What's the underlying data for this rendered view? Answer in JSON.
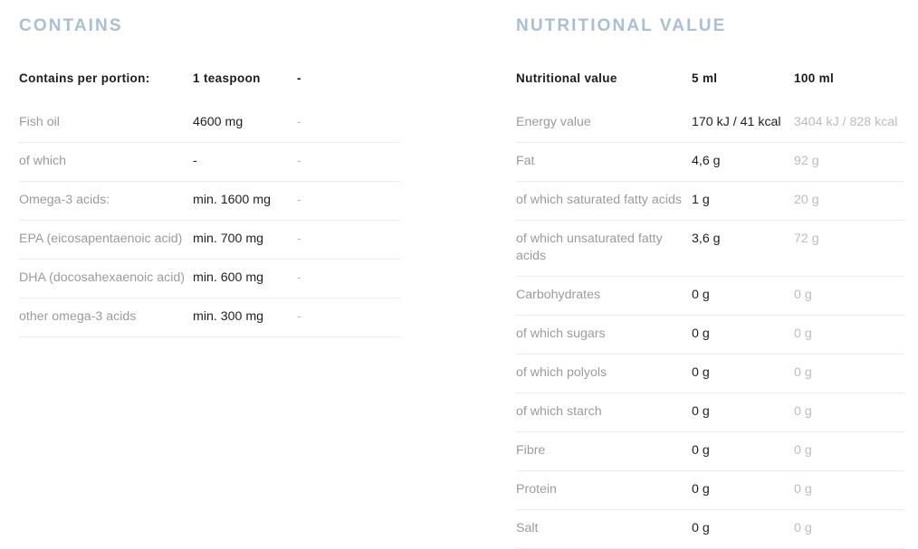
{
  "sections": [
    {
      "id": "contains",
      "title": "CONTAINS",
      "table": {
        "headers": [
          "Contains per portion:",
          "1 teaspoon",
          "-"
        ],
        "rows": [
          {
            "label": "Fish oil",
            "primary": "4600 mg",
            "muted": "-"
          },
          {
            "label": "of which",
            "primary": "-",
            "muted": "-"
          },
          {
            "label": "Omega-3 acids:",
            "primary": "min. 1600 mg",
            "muted": "-"
          },
          {
            "label": "EPA (eicosapentaenoic acid)",
            "primary": "min. 700 mg",
            "muted": "-"
          },
          {
            "label": "DHA (docosahexaenoic acid)",
            "primary": "min. 600 mg",
            "muted": "-"
          },
          {
            "label": "other omega-3 acids",
            "primary": "min. 300 mg",
            "muted": "-"
          }
        ]
      }
    },
    {
      "id": "nutritional-value",
      "title": "NUTRITIONAL VALUE",
      "table": {
        "headers": [
          "Nutritional value",
          "5 ml",
          "100 ml"
        ],
        "rows": [
          {
            "label": "Energy value",
            "primary": "170 kJ / 41 kcal",
            "muted": "3404 kJ / 828 kcal"
          },
          {
            "label": "Fat",
            "primary": "4,6 g",
            "muted": "92 g"
          },
          {
            "label": "of which saturated fatty acids",
            "primary": "1 g",
            "muted": "20 g"
          },
          {
            "label": "of which unsaturated fatty acids",
            "primary": "3,6 g",
            "muted": "72 g"
          },
          {
            "label": "Carbohydrates",
            "primary": "0 g",
            "muted": "0 g"
          },
          {
            "label": "of which sugars",
            "primary": "0 g",
            "muted": "0 g"
          },
          {
            "label": "of which polyols",
            "primary": "0 g",
            "muted": "0 g"
          },
          {
            "label": "of which starch",
            "primary": "0 g",
            "muted": "0 g"
          },
          {
            "label": "Fibre",
            "primary": "0 g",
            "muted": "0 g"
          },
          {
            "label": "Protein",
            "primary": "0 g",
            "muted": "0 g"
          },
          {
            "label": "Salt",
            "primary": "0 g",
            "muted": "0 g"
          }
        ]
      }
    }
  ],
  "colors": {
    "heading": "#a8c0d4",
    "label": "#9b9b9b",
    "primary": "#1f1f1f",
    "muted": "#bcbcbc",
    "rule": "#ececed",
    "background": "#ffffff"
  }
}
